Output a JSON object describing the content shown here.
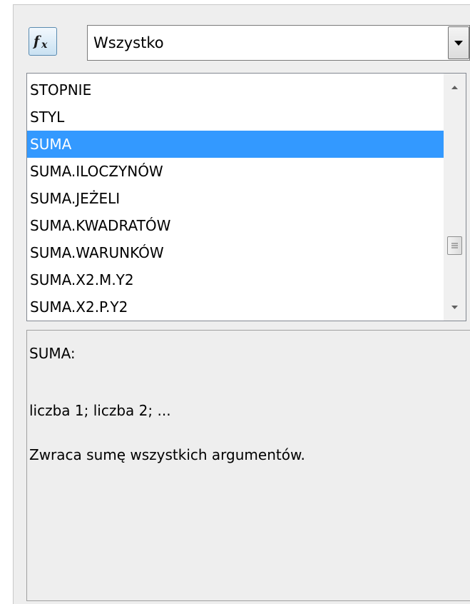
{
  "toolbar": {
    "function_wizard_icon": "fx-icon",
    "category": {
      "selected": "Wszystko"
    }
  },
  "function_list": {
    "items": [
      {
        "label": "STOPNIE",
        "selected": false
      },
      {
        "label": "STYL",
        "selected": false
      },
      {
        "label": "SUMA",
        "selected": true
      },
      {
        "label": "SUMA.ILOCZYNÓW",
        "selected": false
      },
      {
        "label": "SUMA.JEŻELI",
        "selected": false
      },
      {
        "label": "SUMA.KWADRATÓW",
        "selected": false
      },
      {
        "label": "SUMA.WARUNKÓW",
        "selected": false
      },
      {
        "label": "SUMA.X2.M.Y2",
        "selected": false
      },
      {
        "label": "SUMA.X2.P.Y2",
        "selected": false
      }
    ],
    "selection_color": "#3399ff"
  },
  "description": {
    "name": "SUMA:",
    "syntax": "liczba 1; liczba 2; ...",
    "text": "Zwraca sumę wszystkich argumentów."
  }
}
